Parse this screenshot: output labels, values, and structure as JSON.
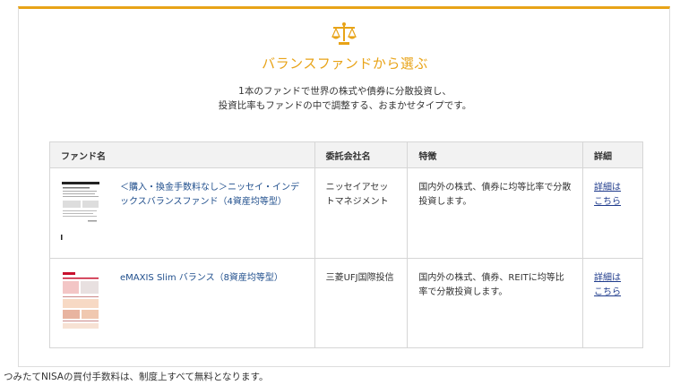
{
  "section": {
    "icon": "scale-icon",
    "heading": "バランスファンドから選ぶ",
    "intro_line1": "1本のファンドで世界の株式や債券に分散投資し、",
    "intro_line2": "投資比率もファンドの中で調整する、おまかせタイプです。"
  },
  "table": {
    "headers": {
      "name": "ファンド名",
      "company": "委託会社名",
      "feature": "特徴",
      "detail": "詳細"
    },
    "rows": [
      {
        "thumbnail": "prospectus-thumbnail",
        "name": "＜購入・換金手数料なし＞ニッセイ・インデックスバランスファンド（4資産均等型）",
        "company": "ニッセイアセットマネジメント",
        "feature": "国内外の株式、債券に均等比率で分散投資します。",
        "detail_line1": "詳細は",
        "detail_line2": "こちら"
      },
      {
        "thumbnail": "prospectus-thumbnail",
        "name": "eMAXIS Slim バランス（8資産均等型）",
        "company": "三菱UFJ国際投信",
        "feature": "国内外の株式、債券、REITに均等比率で分散投資します。",
        "detail_line1": "詳細は",
        "detail_line2": "こちら"
      }
    ]
  },
  "footnote": "つみたてNISAの買付手数料は、制度上すべて無料となります。",
  "colors": {
    "accent": "#e8a317",
    "link": "#1f4e8c",
    "header_bg": "#f2f2f2",
    "border": "#d6d6d6"
  }
}
